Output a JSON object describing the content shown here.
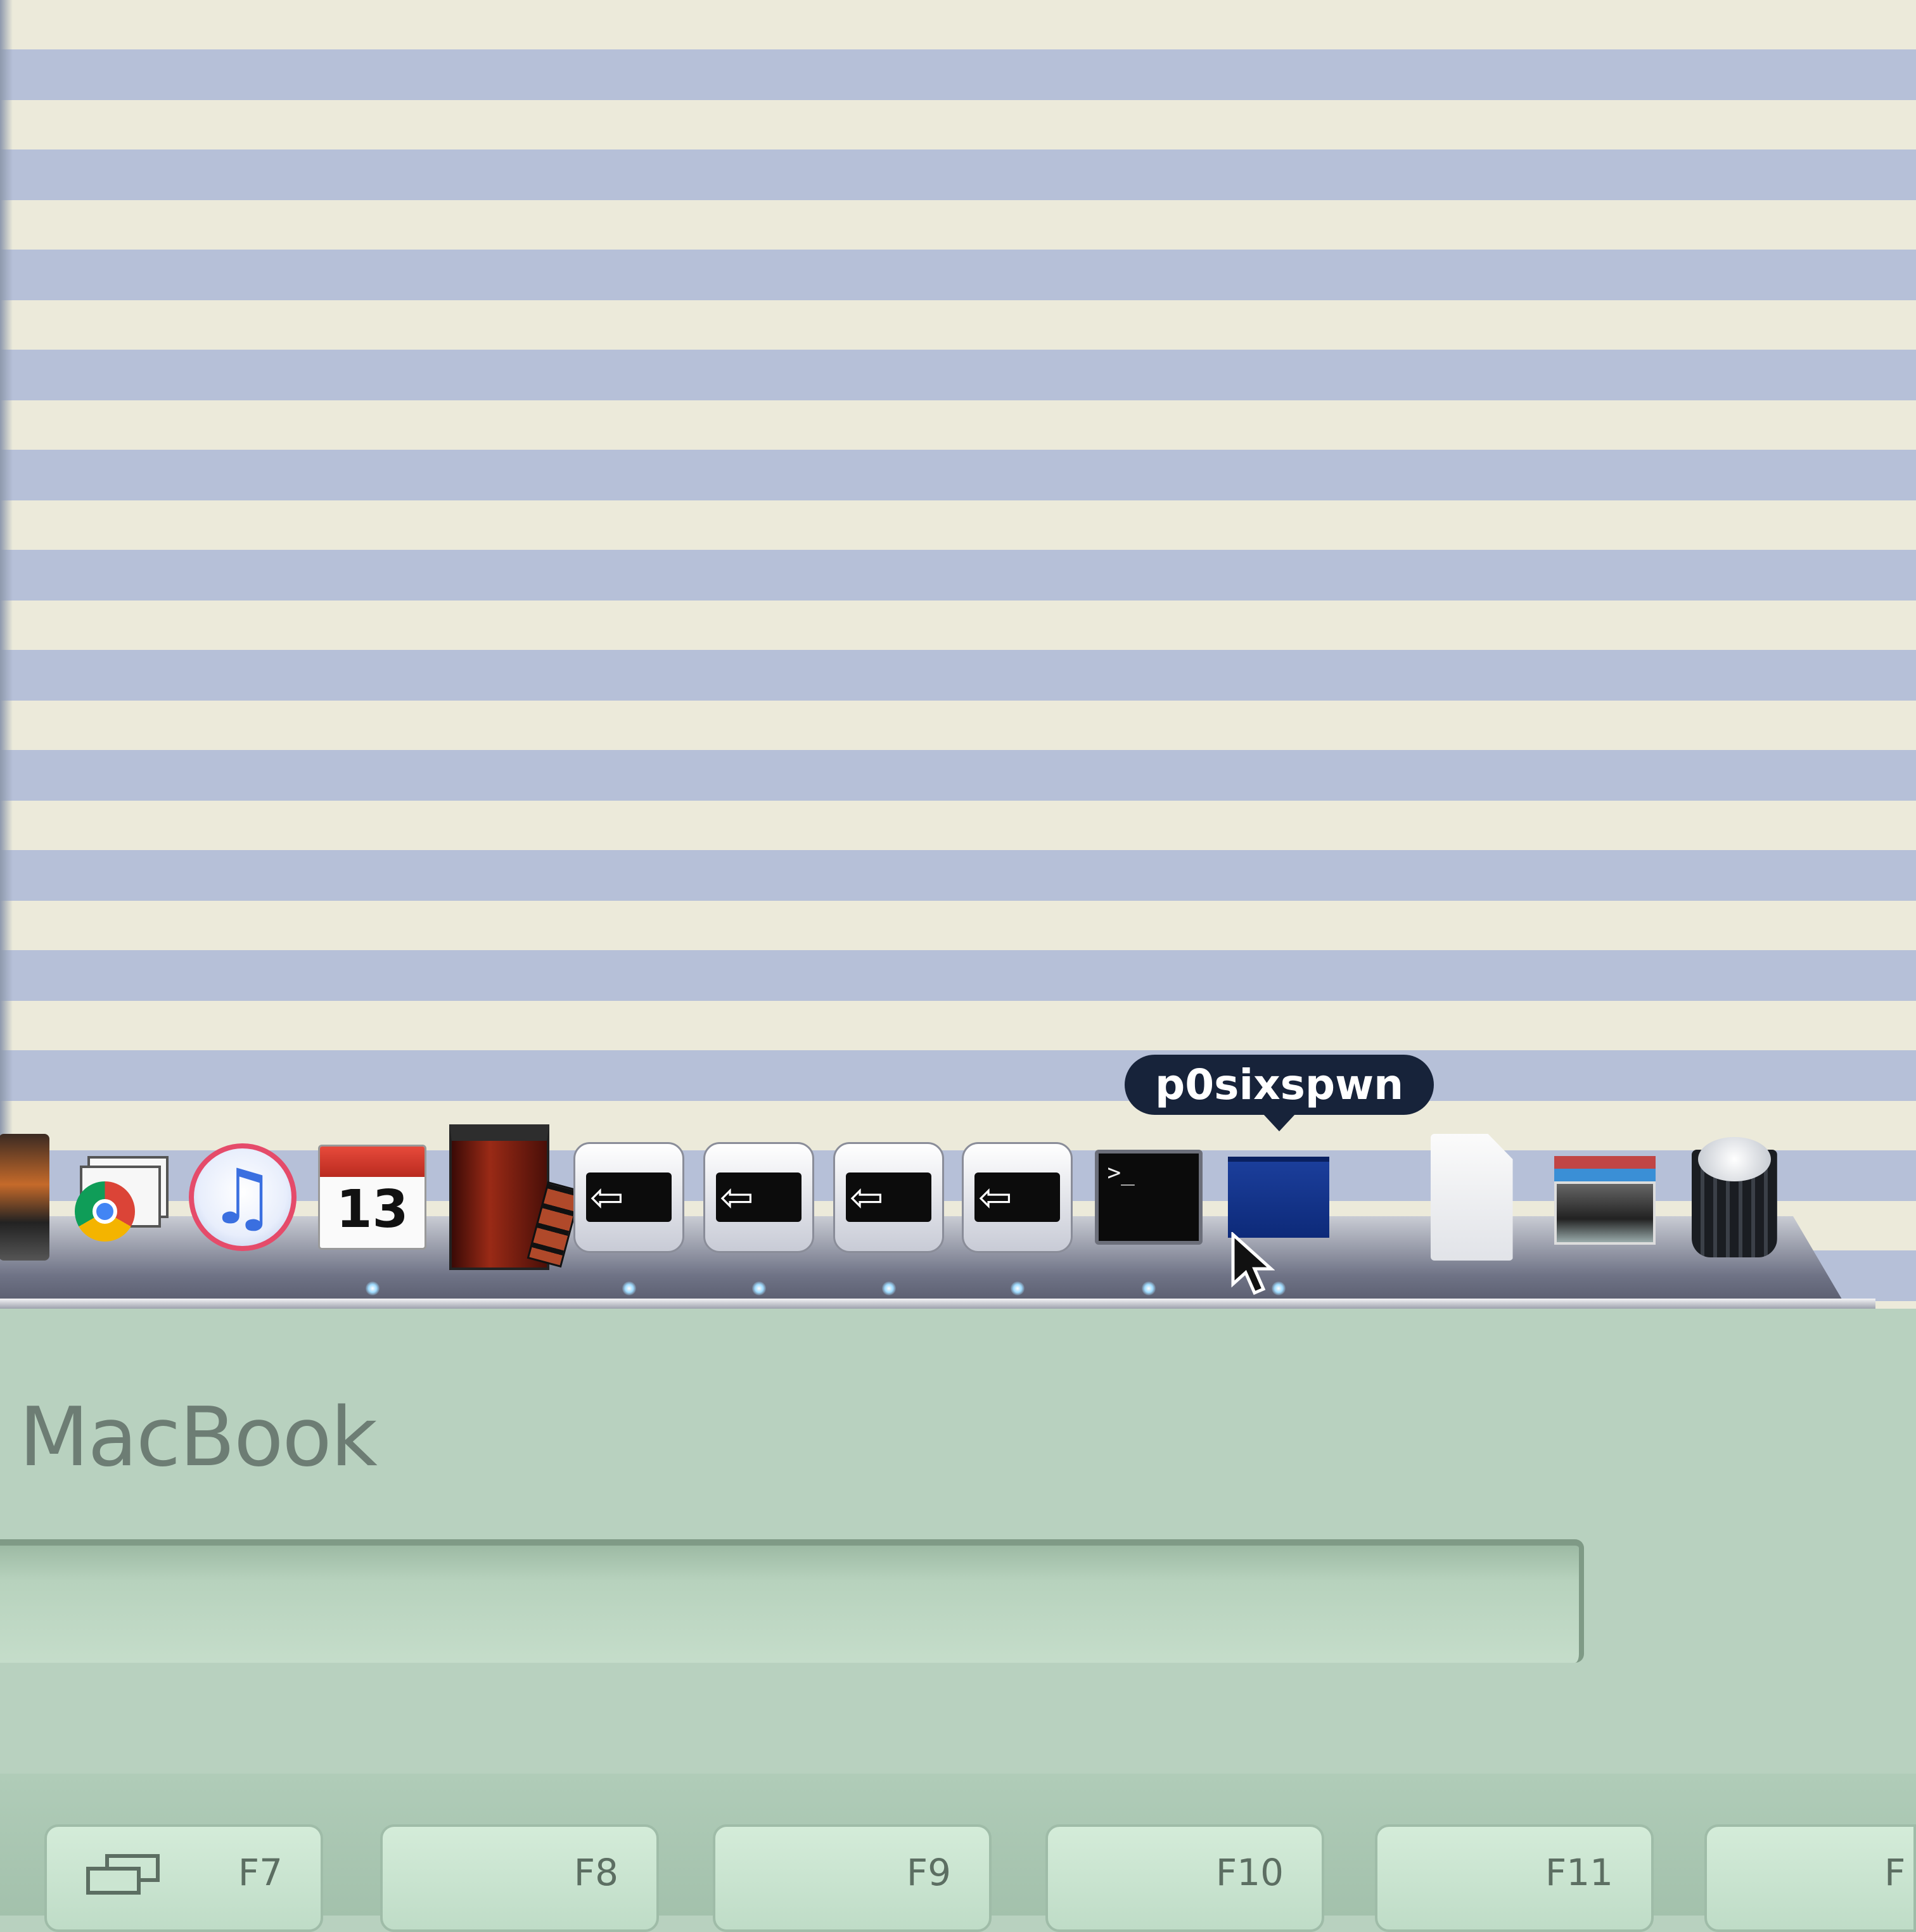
{
  "dock": {
    "items": [
      {
        "name": "Photo Booth",
        "icon": "photo-icon",
        "running": false
      },
      {
        "name": "Google Chrome",
        "icon": "chrome-icon",
        "running": false
      },
      {
        "name": "iTunes",
        "icon": "itunes-icon",
        "running": false
      },
      {
        "name": "iCal",
        "icon": "calendar-icon",
        "day": "13",
        "running": true
      },
      {
        "name": "Photo Booth",
        "icon": "photo-booth-icon",
        "running": false
      },
      {
        "name": "Exec 1",
        "icon": "exec-icon",
        "running": true
      },
      {
        "name": "Exec 2",
        "icon": "exec-icon",
        "running": true
      },
      {
        "name": "Exec 3",
        "icon": "exec-icon",
        "running": true
      },
      {
        "name": "Exec 4",
        "icon": "exec-icon",
        "running": true
      },
      {
        "name": "Terminal",
        "icon": "terminal-icon",
        "prompt": ">_",
        "running": true
      },
      {
        "name": "p0sixspwn",
        "icon": "app-blue-icon",
        "running": true
      },
      {
        "name": "Document",
        "icon": "document-icon",
        "running": false
      },
      {
        "name": "Stack",
        "icon": "folder-stack-icon",
        "running": false
      },
      {
        "name": "Trash",
        "icon": "trash-icon",
        "running": false
      }
    ],
    "tooltip": "p0sixspwn"
  },
  "laptop": {
    "brand": "MacBook",
    "fkeys": [
      "F7",
      "F8",
      "F9",
      "F10",
      "F11",
      "F"
    ]
  },
  "colors": {
    "stripe_light": "#eceada",
    "stripe_dark": "#b6c0d8",
    "case": "#b8d1bf",
    "tooltip_bg": "#17233a"
  }
}
